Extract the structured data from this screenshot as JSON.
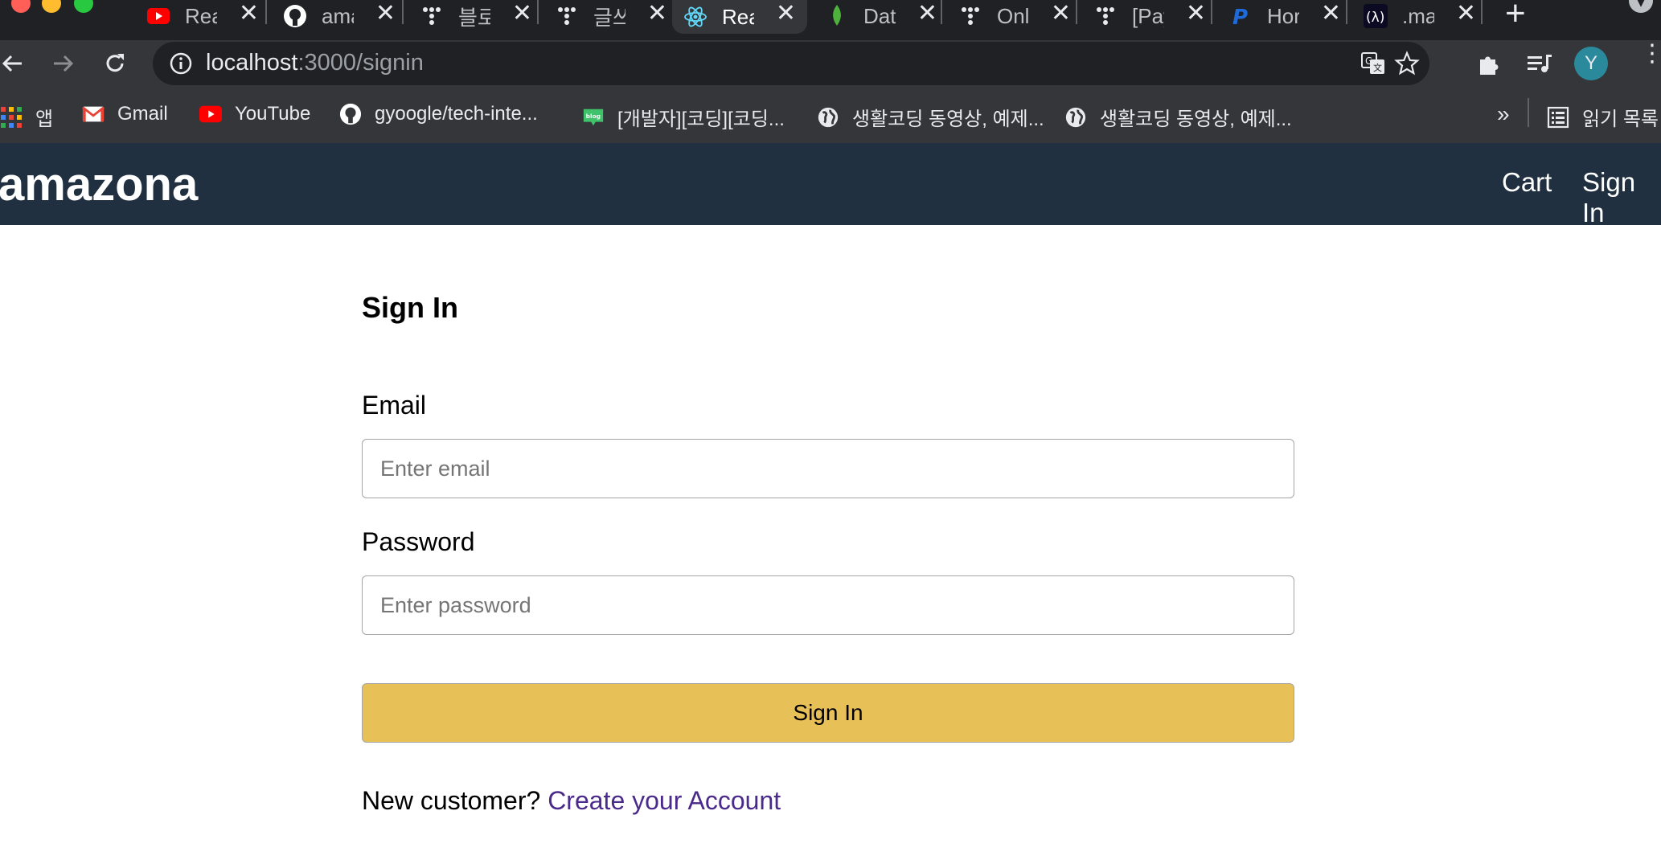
{
  "browser": {
    "tabs": [
      {
        "label": "Rea",
        "icon": "youtube-icon"
      },
      {
        "label": "ama",
        "icon": "github-icon"
      },
      {
        "label": "블로",
        "icon": "tistory-icon"
      },
      {
        "label": "글쓰",
        "icon": "tistory-icon"
      },
      {
        "label": "Rea",
        "icon": "react-icon",
        "active": true
      },
      {
        "label": "Dat",
        "icon": "mongodb-leaf-icon"
      },
      {
        "label": "Onl",
        "icon": "tistory-icon"
      },
      {
        "label": "[Pay",
        "icon": "tistory-icon"
      },
      {
        "label": "Hor",
        "icon": "paypal-icon"
      },
      {
        "label": ".ma",
        "icon": "function-icon"
      }
    ],
    "address": {
      "host": "localhost",
      "path": ":3000/signin"
    },
    "profile_initial": "Y",
    "bookmarks": [
      {
        "label": "앱",
        "icon": "apps-grid-icon"
      },
      {
        "label": "Gmail",
        "icon": "gmail-icon"
      },
      {
        "label": "YouTube",
        "icon": "youtube-icon"
      },
      {
        "label": "gyoogle/tech-inte...",
        "icon": "github-icon"
      },
      {
        "label": "[개발자][코딩][코딩...",
        "icon": "blog-icon"
      },
      {
        "label": "생활코딩 동영상, 예제...",
        "icon": "globe-icon"
      },
      {
        "label": "생활코딩 동영상, 예제...",
        "icon": "globe-icon"
      }
    ],
    "bookmarks_more": "»",
    "reading_list": "읽기 목록"
  },
  "app": {
    "brand": "amazona",
    "nav": {
      "cart": "Cart",
      "signin": "Sign In"
    }
  },
  "form": {
    "title": "Sign In",
    "email_label": "Email",
    "email_placeholder": "Enter email",
    "password_label": "Password",
    "password_placeholder": "Enter password",
    "submit_label": "Sign In",
    "new_customer_text": "New customer?",
    "create_account_link": "Create your Account"
  },
  "colors": {
    "header_bg": "#203040",
    "button_bg": "#e8c058",
    "link": "#4a2a8a"
  }
}
